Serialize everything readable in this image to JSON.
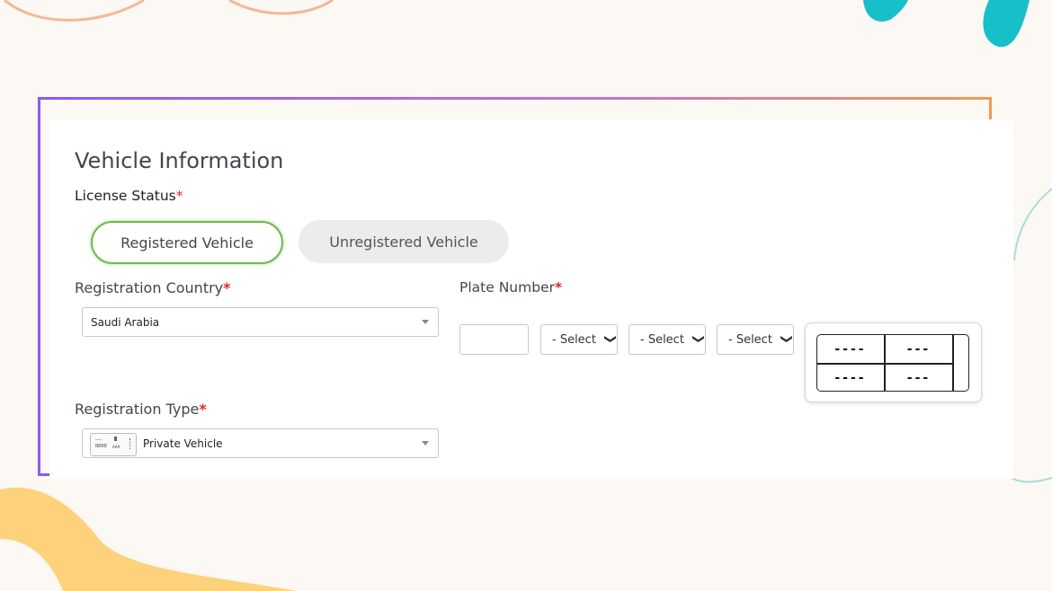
{
  "section_title": "Vehicle Information",
  "license_status": {
    "label": "License Status",
    "required_mark": "*",
    "options": [
      {
        "label": "Registered Vehicle",
        "selected": true
      },
      {
        "label": "Unregistered Vehicle",
        "selected": false
      }
    ]
  },
  "registration_country": {
    "label": "Registration Country",
    "required_mark": "*",
    "value": "Saudi Arabia"
  },
  "plate_number": {
    "label": "Plate Number",
    "required_mark": "*",
    "number_value": "",
    "letter_selects": [
      "- Select",
      "- Select",
      "- Select"
    ],
    "preview": {
      "top_left": "----",
      "top_right": "---",
      "bottom_left": "----",
      "bottom_right": "---"
    }
  },
  "registration_type": {
    "label": "Registration Type",
    "required_mark": "*",
    "value": "Private Vehicle",
    "icon": "plate-thumbnail-icon",
    "icon_text": [
      "....",
      "0000",
      "AAA"
    ]
  },
  "colors": {
    "accent_green": "#6dbb4a",
    "required_red": "#e0262b",
    "frame_gradient_start": "#8a5cf0",
    "frame_gradient_end": "#f29a4c"
  }
}
